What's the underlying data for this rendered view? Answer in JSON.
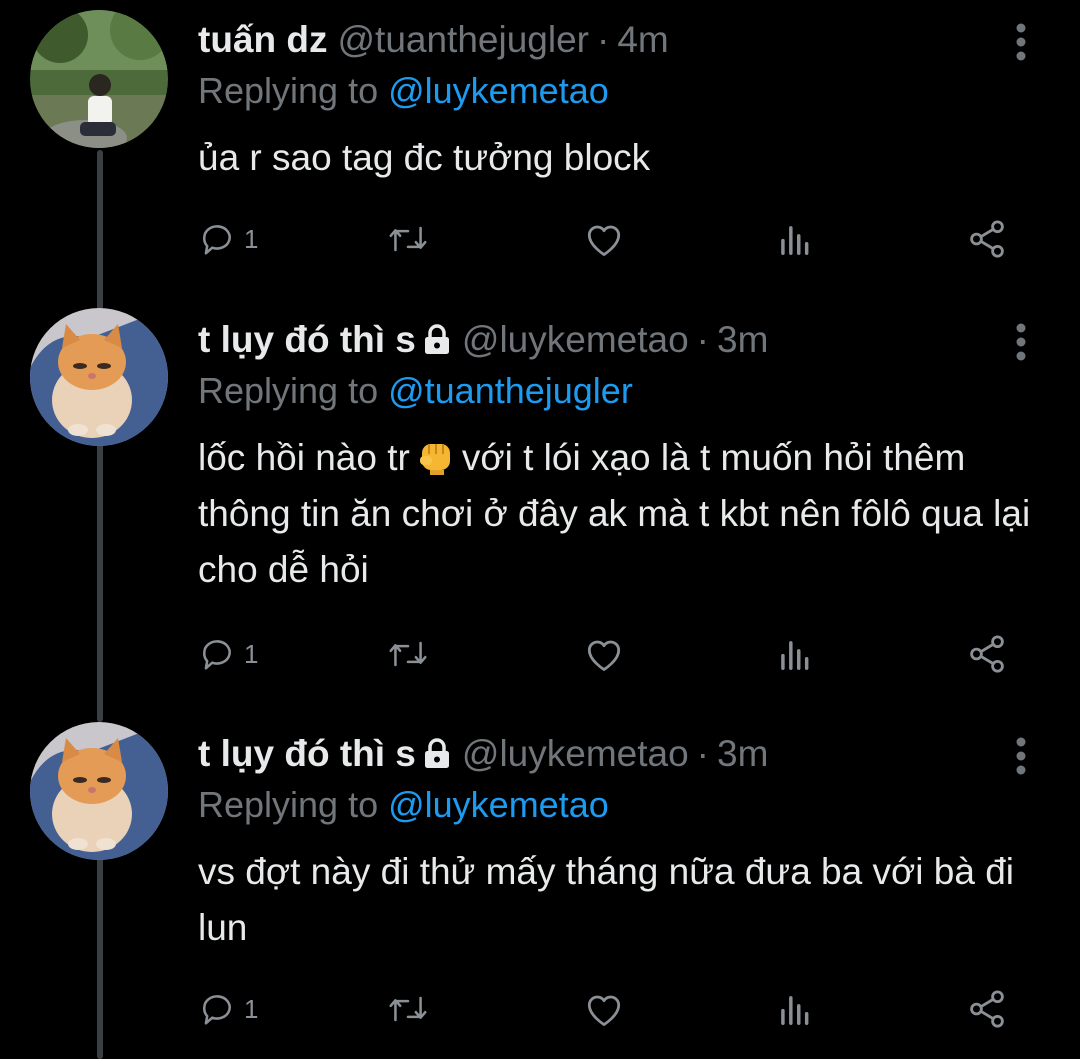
{
  "tweets": [
    {
      "display_name": "tuấn dz",
      "handle": "@tuanthejugler",
      "time": "4m",
      "protected": false,
      "replying_label": "Replying to",
      "replying_to": "@luykemetao",
      "text_parts": [
        "ủa r sao tag đc tưởng block"
      ],
      "reply_count": "1",
      "avatar": "person-photo"
    },
    {
      "display_name": "t lụy đó thì s",
      "handle": "@luykemetao",
      "time": "3m",
      "protected": true,
      "replying_label": "Replying to",
      "replying_to": "@tuanthejugler",
      "text_parts": [
        "lốc hồi nào tr",
        "với t lói xạo là t muốn hỏi thêm thông tin ăn chơi ở đây ak mà t kbt nên fôlô qua lại cho dễ hỏi"
      ],
      "emoji": "oncoming-fist",
      "reply_count": "1",
      "avatar": "cat-photo"
    },
    {
      "display_name": "t lụy đó thì s",
      "handle": "@luykemetao",
      "time": "3m",
      "protected": true,
      "replying_label": "Replying to",
      "replying_to": "@luykemetao",
      "text_parts": [
        "vs đợt này đi thử mấy tháng nữa đưa ba với bà đi lun"
      ],
      "reply_count": "1",
      "avatar": "cat-photo"
    }
  ],
  "separator": "·",
  "colors": {
    "background": "#000000",
    "primary_text": "#e7e9ea",
    "secondary_text": "#71767b",
    "link": "#1d9bf0",
    "thread_line": "#3a3f44"
  },
  "icons": {
    "reply": "reply-icon",
    "retweet": "retweet-icon",
    "like": "heart-icon",
    "views": "views-icon",
    "share": "share-icon",
    "more": "more-vertical-icon",
    "lock": "lock-icon"
  }
}
